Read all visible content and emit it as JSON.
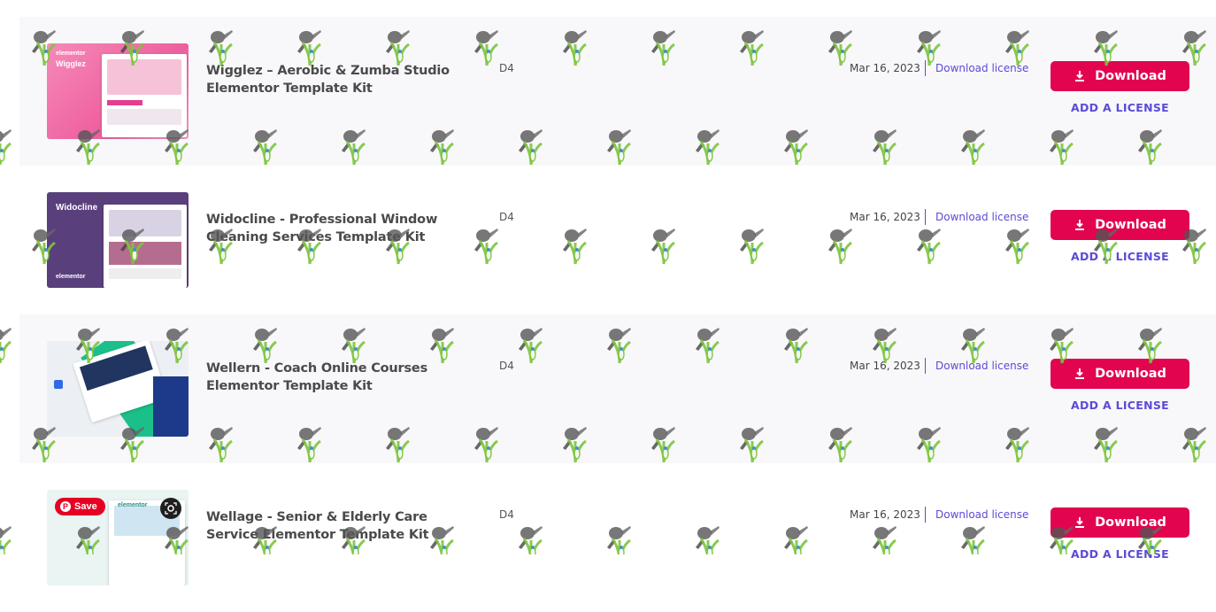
{
  "colors": {
    "accent": "#e2044f",
    "link": "#5b4bd6",
    "row_shaded": "#f8f8fb"
  },
  "items": [
    {
      "title": "Wigglez – Aerobic & Zumba Studio Elementor Template Kit",
      "code": "D4",
      "date": "Mar 16, 2023",
      "license_link": "Download license",
      "download_label": "Download",
      "add_license_label": "ADD A LICENSE",
      "thumb": {
        "brand": "elementor",
        "name": "Wigglez",
        "bg": "#f06ba7"
      }
    },
    {
      "title": "Widocline - Professional Window Cleaning Services Template Kit",
      "code": "D4",
      "date": "Mar 16, 2023",
      "license_link": "Download license",
      "download_label": "Download",
      "add_license_label": "ADD A LICENSE",
      "thumb": {
        "brand": "elementor",
        "name": "Widocline",
        "bg": "#5a3f7d"
      }
    },
    {
      "title": "Wellern - Coach Online Courses Elementor Template Kit",
      "code": "D4",
      "date": "Mar 16, 2023",
      "license_link": "Download license",
      "download_label": "Download",
      "add_license_label": "ADD A LICENSE",
      "thumb": {
        "brand": "",
        "name": "",
        "bg": "#eceff3"
      }
    },
    {
      "title": "Wellage - Senior & Elderly Care Service Elementor Template Kit",
      "code": "D4",
      "date": "Mar 16, 2023",
      "license_link": "Download license",
      "download_label": "Download",
      "add_license_label": "ADD A LICENSE",
      "thumb": {
        "brand": "elementor",
        "name": "",
        "bg": "#e9f4f3"
      }
    }
  ],
  "pinterest": {
    "save_label": "Save"
  }
}
